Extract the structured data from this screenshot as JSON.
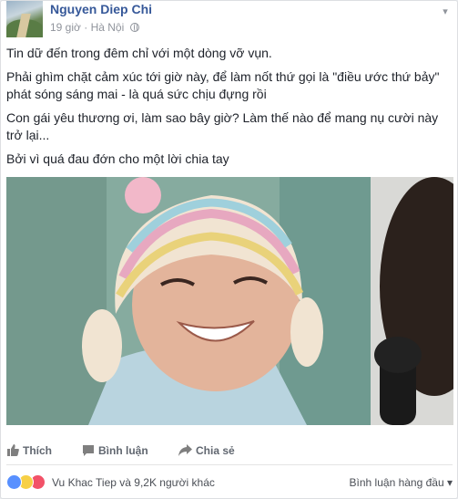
{
  "post": {
    "author": "Nguyen Diep Chi",
    "time": "19 giờ",
    "separator": "·",
    "location": "Hà Nội",
    "icons": {
      "audience": "globe-icon",
      "menu": "chevron-down-icon"
    }
  },
  "content": {
    "paragraphs": [
      "Tin dữ đến trong đêm chỉ với một dòng vỡ vụn.",
      "Phải ghìm chặt cảm xúc tới giờ này, để làm nốt thứ gọi là \"điều ước thứ bảy\" phát sóng sáng mai - là quá sức chịu đựng rồi",
      "Con gái yêu thương ơi, làm sao bây giờ? Làm thế nào để mang nụ cười này trở lại...",
      "Bởi vì quá đau đớn cho một lời chia tay"
    ]
  },
  "actions": {
    "like": "Thích",
    "comment": "Bình luận",
    "share": "Chia sẻ"
  },
  "reactions": {
    "summary": "Vu Khac Tiep và 9,2K người khác",
    "sort_label": "Bình luận hàng đầu",
    "sort_arrow": "▾",
    "icons": [
      "like-icon",
      "sad-icon",
      "love-icon"
    ]
  },
  "colors": {
    "author": "#365899",
    "meta": "#90949c",
    "like": "#5890ff",
    "love": "#f25268",
    "sad": "#f7d046"
  }
}
